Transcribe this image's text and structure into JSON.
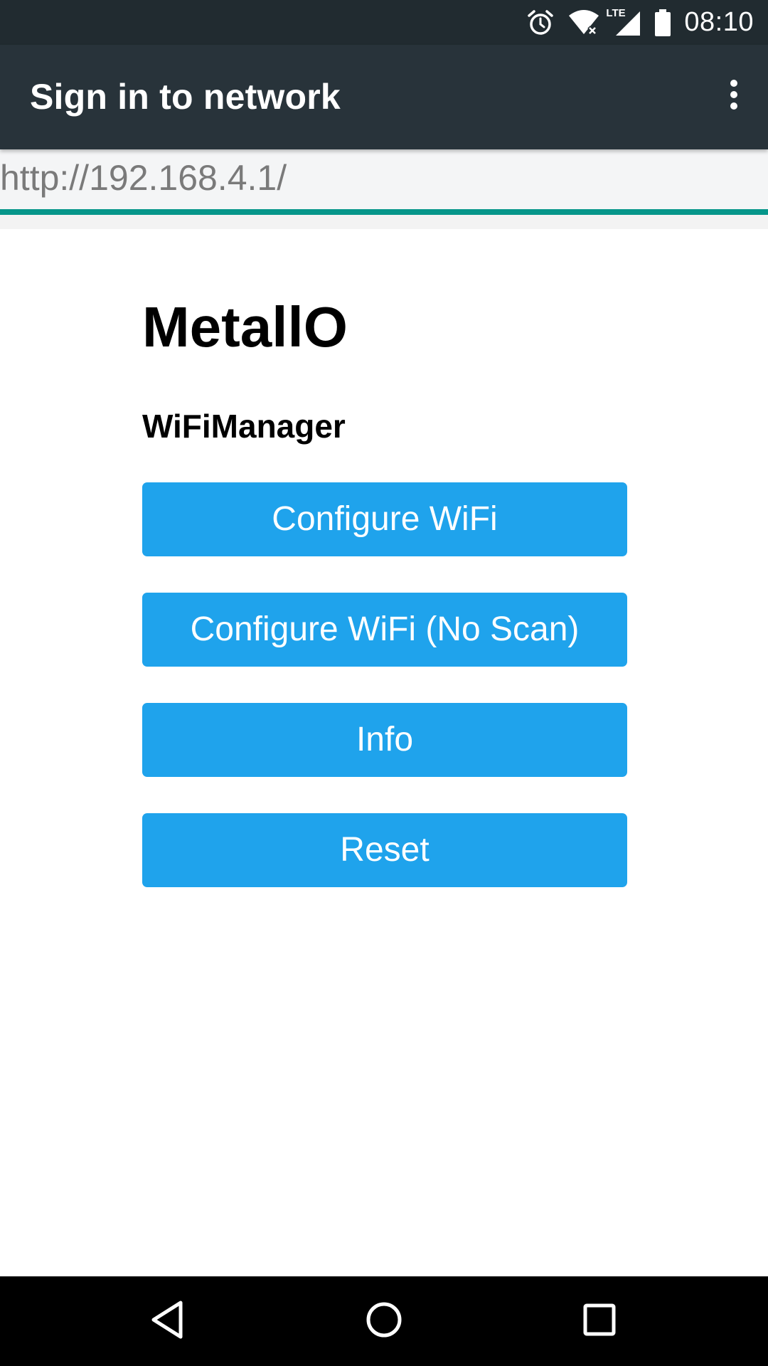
{
  "status_bar": {
    "time": "08:10",
    "network_label": "LTE",
    "icons": [
      "alarm-icon",
      "wifi-no-internet-icon",
      "lte-signal-icon",
      "battery-icon"
    ]
  },
  "app_bar": {
    "title": "Sign in to network",
    "menu_icon": "more-vert-icon"
  },
  "url_bar": {
    "url": "http://192.168.4.1/",
    "load_progress": 1.0
  },
  "page": {
    "heading": "MetallO",
    "subheading": "WiFiManager",
    "buttons": [
      {
        "label": "Configure WiFi"
      },
      {
        "label": "Configure WiFi (No Scan)"
      },
      {
        "label": "Info"
      },
      {
        "label": "Reset"
      }
    ]
  },
  "nav_bar": {
    "icons": [
      "back-icon",
      "home-icon",
      "recents-icon"
    ]
  },
  "colors": {
    "status_bar": "#212b30",
    "app_bar": "#28333a",
    "progress": "#06968a",
    "button": "#1fa3ec"
  }
}
